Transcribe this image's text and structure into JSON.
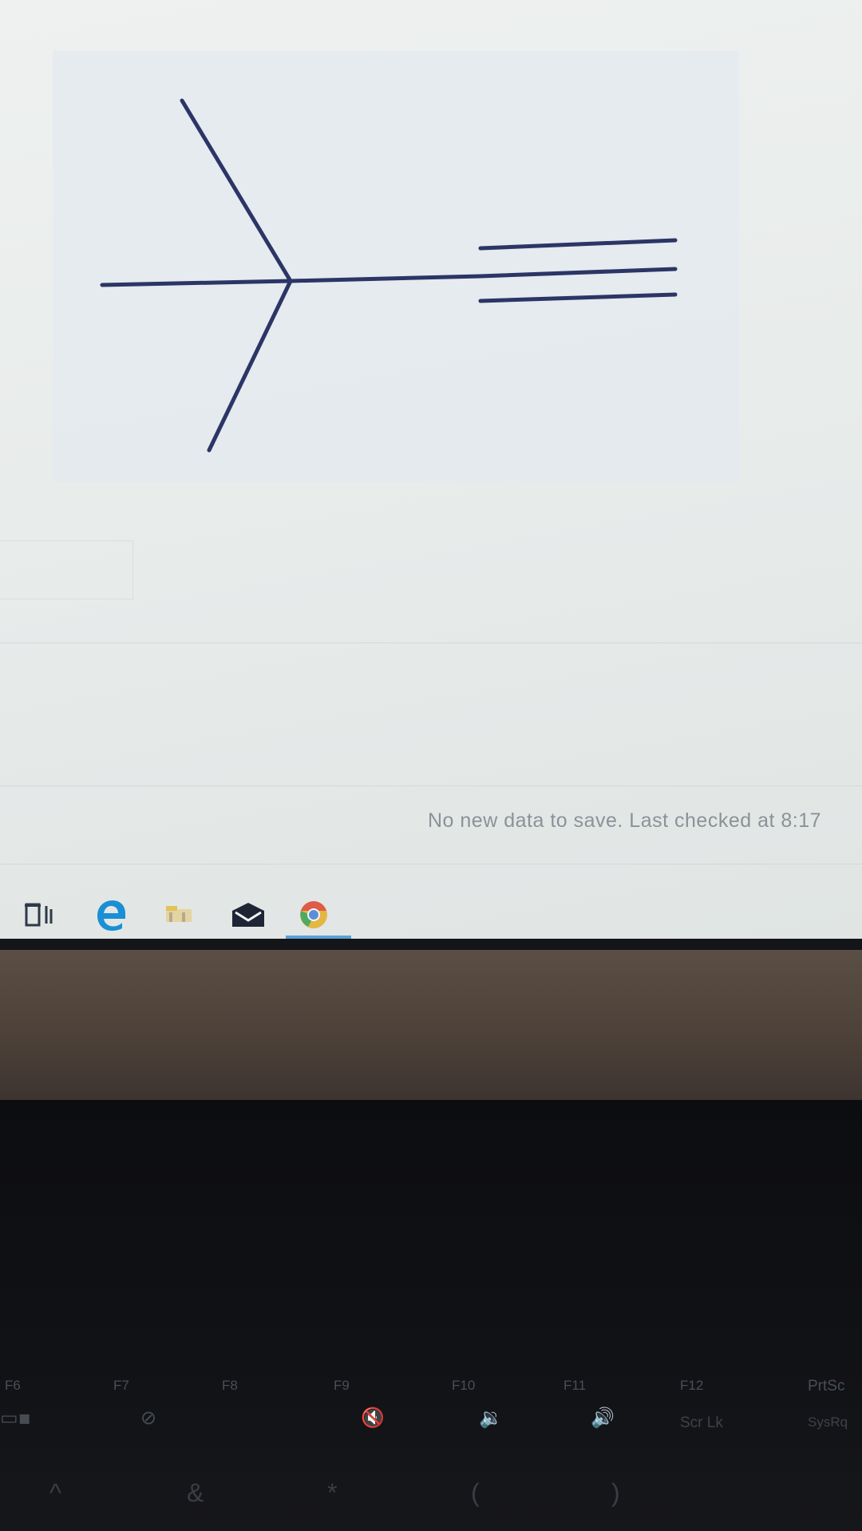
{
  "screen": {
    "status_text": "No new data to save. Last checked at 8:17"
  },
  "taskbar": {
    "icons": [
      "task-view-icon",
      "edge-browser-icon",
      "file-explorer-icon",
      "mail-icon",
      "chrome-icon"
    ]
  },
  "keyboard": {
    "function_keys": [
      {
        "label": "F6",
        "sub": ""
      },
      {
        "label": "F7",
        "sub": ""
      },
      {
        "label": "F8",
        "sub": ""
      },
      {
        "label": "F9",
        "sub": ""
      },
      {
        "label": "F10",
        "sub": ""
      },
      {
        "label": "F11",
        "sub": ""
      },
      {
        "label": "F12",
        "sub": "Scr Lk"
      },
      {
        "label": "PrtSc",
        "sub": "SysRq"
      }
    ],
    "symbol_keys": [
      "^",
      "&",
      "*",
      "(",
      ")"
    ]
  },
  "colors": {
    "bond_color": "#2b3566",
    "screen_bg": "#e9edec",
    "status_text": "#8b9297",
    "chrome_active": "#5aa0d6"
  }
}
